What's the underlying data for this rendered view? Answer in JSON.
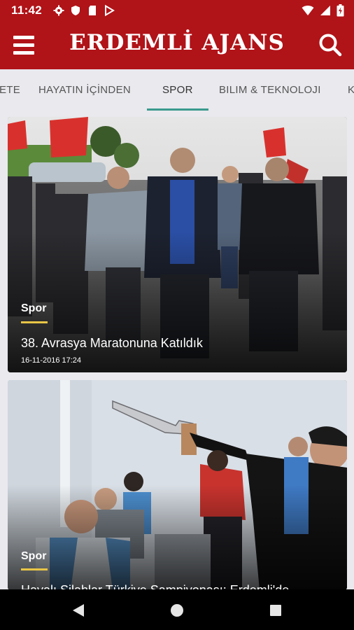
{
  "status_bar": {
    "time": "11:42",
    "icons": [
      "gear-icon",
      "shield-icon",
      "sd-card-icon",
      "play-store-icon"
    ],
    "right_icons": [
      "wifi-icon",
      "signal-icon",
      "battery-icon"
    ]
  },
  "app_bar": {
    "title": "ERDEMLİ AJANS",
    "menu_icon": "hamburger-menu-icon",
    "search_icon": "search-icon"
  },
  "tabs": {
    "items": [
      {
        "label": "ETE"
      },
      {
        "label": "HAYATIN İÇİNDEN"
      },
      {
        "label": "SPOR"
      },
      {
        "label": "BILIM & TEKNOLOJI"
      },
      {
        "label": "K"
      }
    ],
    "active": "SPOR",
    "indicator_color": "#3b9a8e"
  },
  "articles": [
    {
      "category": "Spor",
      "title": "38. Avrasya Maratonuna Katıldık",
      "date": "16-11-2016 17:24"
    },
    {
      "category": "Spor",
      "title": "Havalı Silahlar Türkiye Şampiyonası: Erdemli'de"
    }
  ],
  "colors": {
    "brand": "#b01318",
    "category_underline": "#e8c546",
    "background": "#e9e9ee"
  },
  "nav_bar": {
    "icons": [
      "back-icon",
      "home-icon",
      "recents-icon"
    ]
  }
}
